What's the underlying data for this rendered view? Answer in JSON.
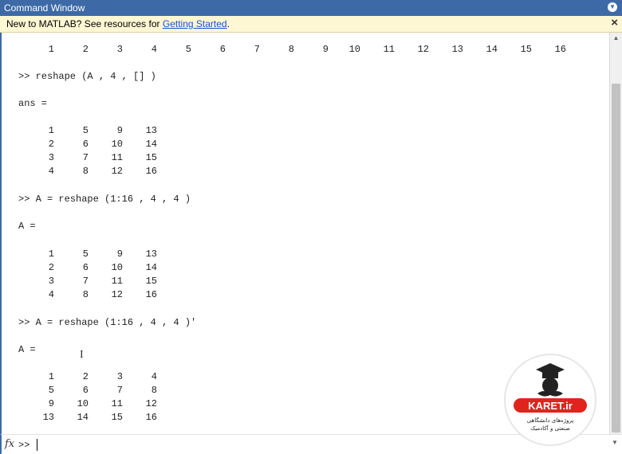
{
  "window": {
    "title": "Command Window",
    "menu_icon": "chevron-down-icon"
  },
  "infobar": {
    "message": "New to MATLAB? See resources for ",
    "link": "Getting Started",
    "suffix": ".",
    "close_icon": "close-icon"
  },
  "console": {
    "top_row": [
      "1",
      "2",
      "3",
      "4",
      "5",
      "6",
      "7",
      "8",
      "9",
      "10",
      "11",
      "12",
      "13",
      "14",
      "15",
      "16"
    ],
    "cmd1": ">> reshape (A , 4 , [] )",
    "label1": "ans =",
    "matrix1": [
      [
        "1",
        "5",
        "9",
        "13"
      ],
      [
        "2",
        "6",
        "10",
        "14"
      ],
      [
        "3",
        "7",
        "11",
        "15"
      ],
      [
        "4",
        "8",
        "12",
        "16"
      ]
    ],
    "cmd2": ">> A = reshape (1:16 , 4 , 4 )",
    "label2": "A =",
    "matrix2": [
      [
        "1",
        "5",
        "9",
        "13"
      ],
      [
        "2",
        "6",
        "10",
        "14"
      ],
      [
        "3",
        "7",
        "11",
        "15"
      ],
      [
        "4",
        "8",
        "12",
        "16"
      ]
    ],
    "cmd3": ">> A = reshape (1:16 , 4 , 4 )'",
    "label3": "A =",
    "matrix3": [
      [
        "1",
        "2",
        "3",
        "4"
      ],
      [
        "5",
        "6",
        "7",
        "8"
      ],
      [
        "9",
        "10",
        "11",
        "12"
      ],
      [
        "13",
        "14",
        "15",
        "16"
      ]
    ]
  },
  "prompt": {
    "fx_label": "fx",
    "prompt_text": ">>"
  },
  "watermark": {
    "brand": "KARET.ir",
    "tagline_1": "پروژه‌های دانشگاهی",
    "tagline_2": "صنعتی و آکادمیک"
  }
}
